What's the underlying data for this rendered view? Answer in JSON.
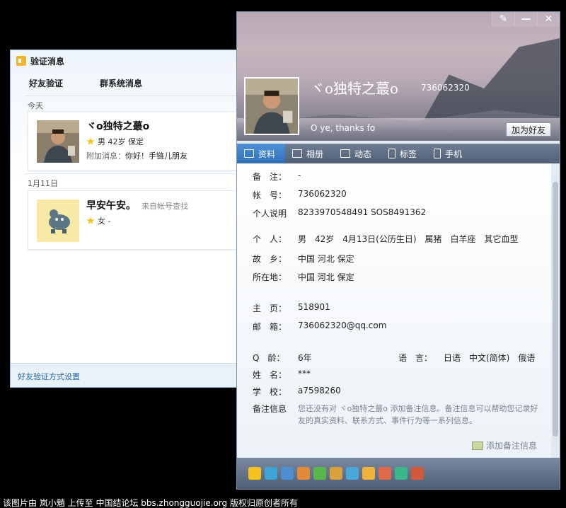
{
  "verify": {
    "title": "验证消息",
    "tabs": [
      "好友验证",
      "群系统消息"
    ],
    "groups": [
      {
        "date": "今天",
        "card": {
          "name": "ヾo独特之蕞o",
          "info": "男 42岁 保定",
          "msg_key": "附加消息：",
          "msg": "你好！手链儿朋友"
        }
      },
      {
        "date": "1月11日",
        "card": {
          "name": "早安午安。",
          "source": "来自帐号查找",
          "info": "女 -"
        }
      }
    ],
    "footer_link": "好友验证方式设置"
  },
  "profile": {
    "window_buttons": [
      "skin",
      "minimize",
      "close"
    ],
    "name": "ヾo独特之蕞o",
    "qq": "736062320",
    "signature": "O ye, thanks fo",
    "add_friend": "加为好友",
    "tabs": [
      "资料",
      "相册",
      "动态",
      "标签",
      "手机"
    ],
    "fields": [
      {
        "label": "备　注：",
        "value": "-"
      },
      {
        "label": "帐　号：",
        "value": "736062320"
      },
      {
        "label": "个人说明",
        "value": "8233970548491 SOS8491362"
      },
      {
        "label": "个　人：",
        "value": "男　42岁　4月13日(公历生日)　属猪　白羊座　其它血型"
      },
      {
        "label": "故　乡：",
        "value": "中国 河北 保定"
      },
      {
        "label": "所在地：",
        "value": "中国 河北 保定"
      },
      {
        "label": "主　页：",
        "value": "518901"
      },
      {
        "label": "邮　箱：",
        "value": "736062320@qq.com"
      },
      {
        "label": "Q　龄：",
        "value": "6年"
      },
      {
        "label": "姓　名：",
        "value": "***"
      },
      {
        "label": "学　校：",
        "value": "a7598260"
      }
    ],
    "language": {
      "label": "语　言：",
      "value": "日语　中文(简体)　俄语"
    },
    "remark": {
      "label": "备注信息",
      "text": "您还没有对 ヾo独特之蕞o 添加备注信息。备注信息可以帮助您记录好友的真实资料、联系方式、事件行为等一系列信息。"
    },
    "add_remark": "添加备注信息"
  },
  "caption": "该图片由 岚小魈 上传至 中国结论坛 bbs.zhongguojie.org 版权归原创者所有",
  "colors": {
    "accent": "#2f6fb8",
    "link": "#2a67a8",
    "star": "#f4c21b"
  }
}
